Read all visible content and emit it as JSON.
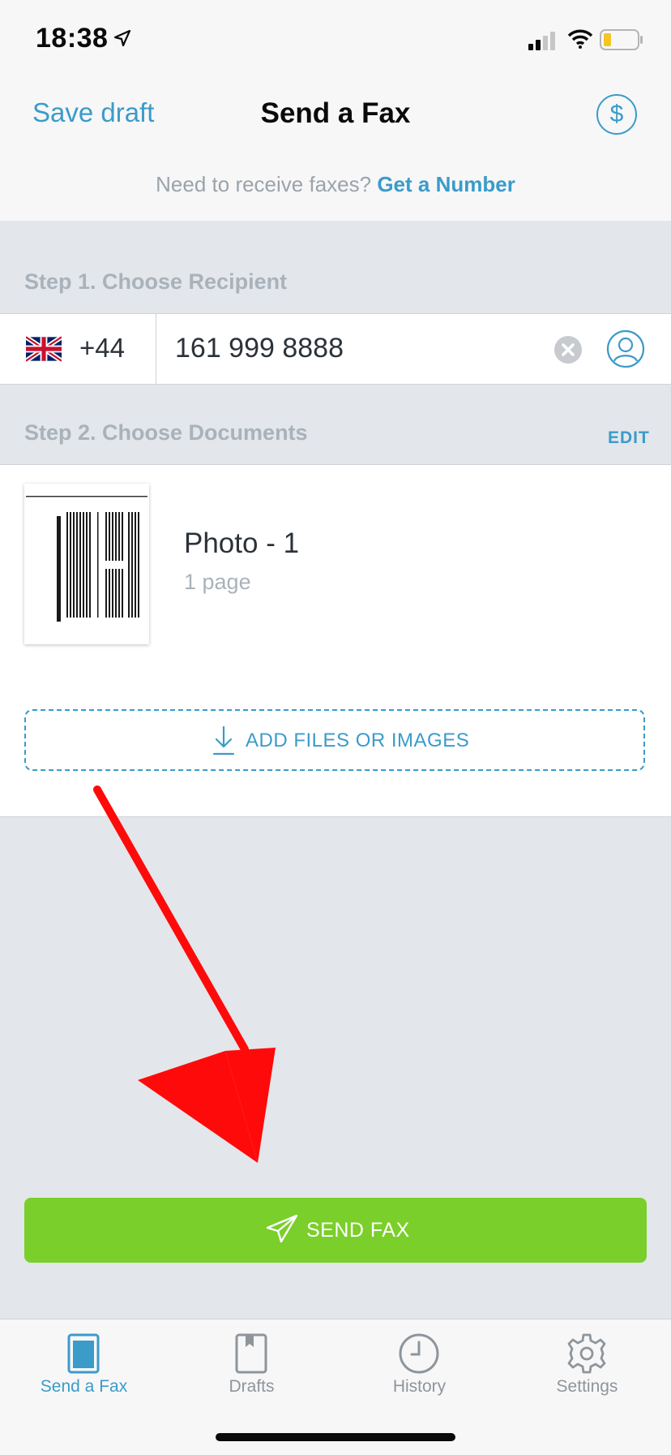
{
  "status_bar": {
    "time": "18:38"
  },
  "nav": {
    "save_draft": "Save draft",
    "title": "Send a Fax",
    "credits_symbol": "$"
  },
  "promo": {
    "text": "Need to receive faxes?",
    "link": "Get a Number"
  },
  "step1": {
    "title": "Step 1. Choose Recipient",
    "country_code": "+44",
    "phone_number": "161 999 8888"
  },
  "step2": {
    "title": "Step 2. Choose Documents",
    "edit_label": "EDIT",
    "documents": [
      {
        "name": "Photo - 1",
        "pages": "1 page"
      }
    ],
    "add_label": "ADD FILES OR IMAGES"
  },
  "send": {
    "label": "SEND FAX"
  },
  "tabs": [
    {
      "label": "Send a Fax",
      "icon": "send-fax-icon",
      "active": true
    },
    {
      "label": "Drafts",
      "icon": "drafts-icon",
      "active": false
    },
    {
      "label": "History",
      "icon": "history-icon",
      "active": false
    },
    {
      "label": "Settings",
      "icon": "settings-icon",
      "active": false
    }
  ],
  "colors": {
    "accent": "#3b9bc9",
    "send_green": "#7acf2a",
    "annotation_red": "#ff0a0a",
    "background": "#e3e6ea"
  }
}
